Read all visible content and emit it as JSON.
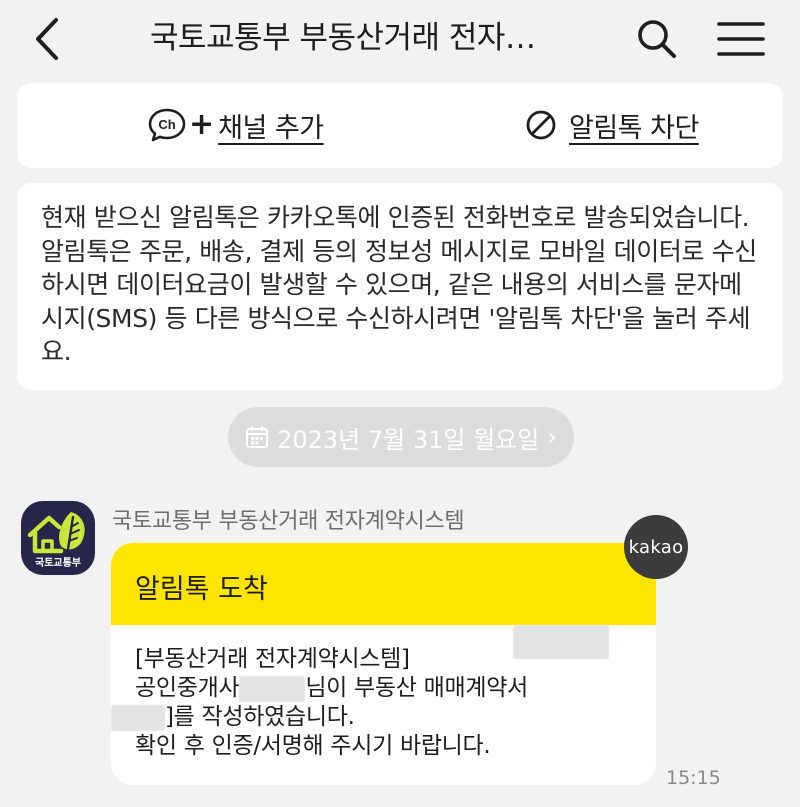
{
  "header": {
    "title": "국토교통부 부동산거래 전자…",
    "back_icon": "chevron-left-icon",
    "search_icon": "search-icon",
    "menu_icon": "hamburger-menu-icon"
  },
  "channel": {
    "add_label": "채널 추가",
    "ch_icon_text": "Ch",
    "plus": "+",
    "block_label": "알림톡 차단"
  },
  "notice": {
    "lines": [
      "현재 받으신 알림톡은 카카오톡에 인증된 전화번호로 발송되었습니다.",
      "알림톡은 주문, 배송, 결제 등의 정보성 메시지로 모바일 데이터로 수신",
      "하시면 데이터요금이 발생할 수 있으며, 같은 내용의 서비스를 문자메",
      "시지(SMS) 등 다른 방식으로 수신하시려면 '알림톡 차단'을 눌러 주세",
      "요."
    ]
  },
  "date": {
    "label": "2023년 7월 31일 월요일",
    "chevron": "›"
  },
  "sender": {
    "name": "국토교통부 부동산거래 전자계약시스템",
    "avatar_caption": "국토교통부"
  },
  "message": {
    "header": "알림톡 도착",
    "line1": "[부동산거래 전자계약시스템]",
    "line2_prefix": "공인중개사",
    "line2_suffix": "님이 부동산 매매계약서",
    "line3_suffix": "]를 작성하였습니다.",
    "line4": "확인 후 인증/서명해 주시기 바랍니다.",
    "time": "15:15",
    "badge": "kakao"
  },
  "colors": {
    "background": "#f2f2f2",
    "card": "#ffffff",
    "kakao_yellow": "#fee500",
    "date_pill": "#dcdcdc",
    "avatar_bg": "#26264a",
    "avatar_green": "#c8e63c",
    "badge_bg": "#3c3c3c"
  }
}
